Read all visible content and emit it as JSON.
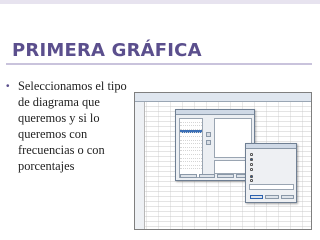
{
  "slide": {
    "title": "PRIMERA GRÁFICA",
    "bullet_symbol": "•",
    "bullet_text": "Seleccionamos el tipo de diagrama que queremos y si lo queremos con frecuencias o con porcentajes"
  },
  "colors": {
    "title": "#5b4f8d",
    "accent_band": "#e7e3ef"
  }
}
